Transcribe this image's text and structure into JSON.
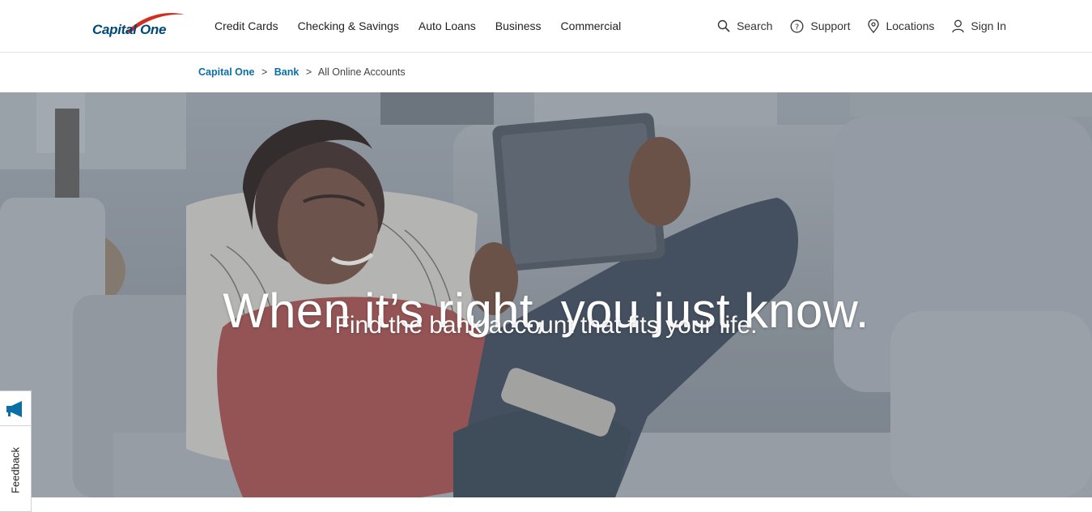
{
  "brand": {
    "logo_text": "Capital One"
  },
  "nav": {
    "items": [
      {
        "label": "Credit Cards"
      },
      {
        "label": "Checking & Savings"
      },
      {
        "label": "Auto Loans"
      },
      {
        "label": "Business"
      },
      {
        "label": "Commercial"
      }
    ]
  },
  "utility": {
    "search": {
      "label": "Search",
      "icon": "search-icon"
    },
    "support": {
      "label": "Support",
      "icon": "help-circle-icon"
    },
    "locations": {
      "label": "Locations",
      "icon": "map-pin-icon"
    },
    "signin": {
      "label": "Sign In",
      "icon": "user-icon"
    }
  },
  "breadcrumb": {
    "items": [
      "Capital One",
      "Bank",
      "All Online Accounts"
    ],
    "separator": ">"
  },
  "hero": {
    "title": "When it’s right, you just know.",
    "subtitle": "Find the bank account that fits your life."
  },
  "feedback": {
    "label": "Feedback",
    "icon": "megaphone-icon"
  },
  "colors": {
    "brand_navy": "#004977",
    "brand_red": "#d22e1e",
    "link_blue": "#0a6fa6",
    "feedback_icon": "#0a6fa6"
  }
}
